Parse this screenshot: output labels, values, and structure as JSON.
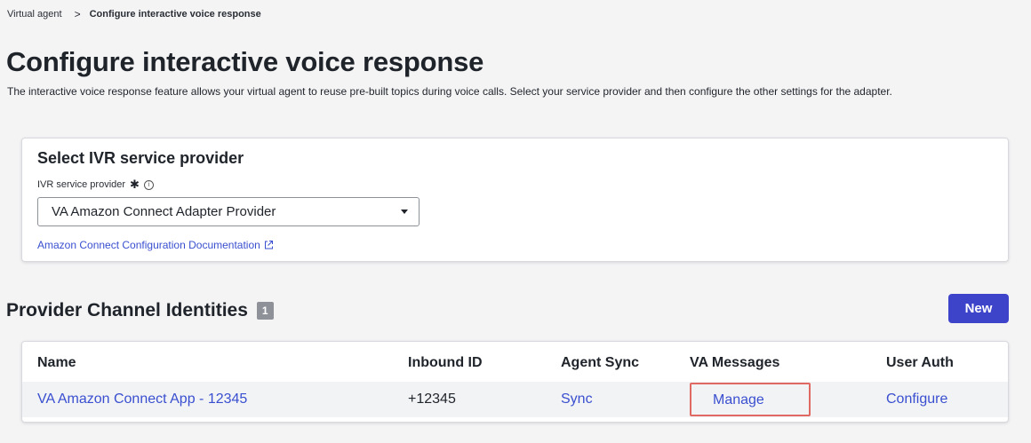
{
  "breadcrumb": {
    "parent": "Virtual agent",
    "separator": ">",
    "current": "Configure interactive voice response"
  },
  "page": {
    "title": "Configure interactive voice response",
    "description": "The interactive voice response feature allows your virtual agent to reuse pre-built topics during voice calls. Select your service provider and then configure the other settings for the adapter."
  },
  "provider_card": {
    "title": "Select IVR service provider",
    "field_label": "IVR service provider",
    "selected_value": "VA Amazon Connect Adapter Provider",
    "doc_link": "Amazon Connect Configuration Documentation"
  },
  "identities": {
    "title": "Provider Channel Identities",
    "count": "1",
    "new_label": "New",
    "columns": [
      "Name",
      "Inbound ID",
      "Agent Sync",
      "VA Messages",
      "User Auth"
    ],
    "rows": [
      {
        "name": "VA Amazon Connect App - 12345",
        "inbound_id": "+12345",
        "agent_sync": "Sync",
        "va_messages": "Manage",
        "user_auth": "Configure"
      }
    ]
  },
  "colors": {
    "accent": "#3d44c9",
    "link": "#3a4fd0",
    "highlight": "#e06a63"
  }
}
